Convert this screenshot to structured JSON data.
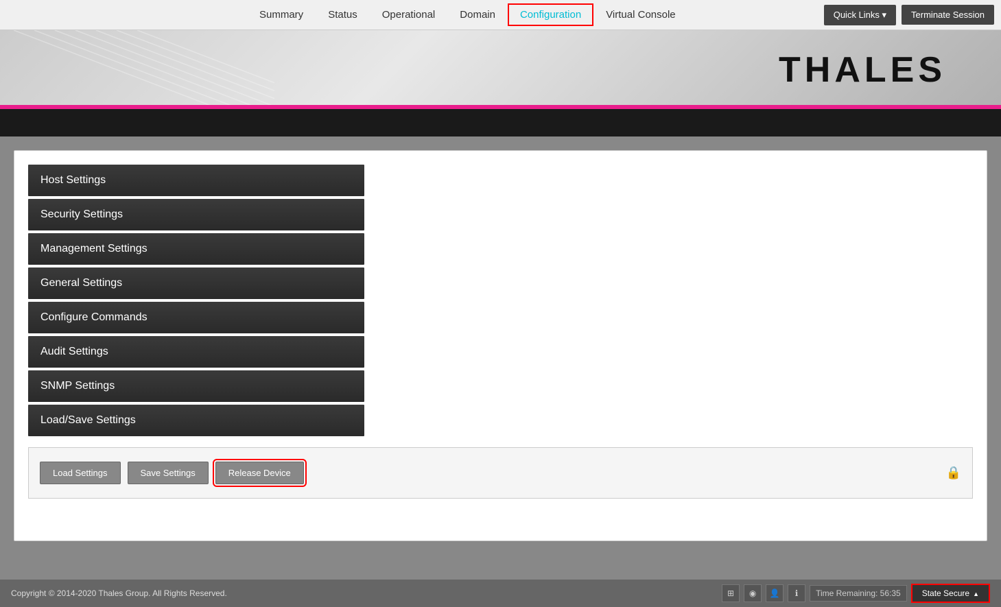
{
  "nav": {
    "links": [
      {
        "label": "Summary",
        "id": "summary",
        "active": false
      },
      {
        "label": "Status",
        "id": "status",
        "active": false
      },
      {
        "label": "Operational",
        "id": "operational",
        "active": false
      },
      {
        "label": "Domain",
        "id": "domain",
        "active": false
      },
      {
        "label": "Configuration",
        "id": "configuration",
        "active": true
      },
      {
        "label": "Virtual Console",
        "id": "virtual-console",
        "active": false
      }
    ],
    "quick_links_label": "Quick Links ▾",
    "terminate_label": "Terminate Session"
  },
  "header": {
    "logo": "THALES"
  },
  "menu": {
    "items": [
      {
        "label": "Host Settings"
      },
      {
        "label": "Security Settings"
      },
      {
        "label": "Management Settings"
      },
      {
        "label": "General Settings"
      },
      {
        "label": "Configure Commands"
      },
      {
        "label": "Audit Settings"
      },
      {
        "label": "SNMP Settings"
      },
      {
        "label": "Load/Save Settings"
      }
    ]
  },
  "actions": {
    "load_label": "Load Settings",
    "save_label": "Save Settings",
    "release_label": "Release Device"
  },
  "footer": {
    "copyright": "Copyright © 2014-2020 Thales Group. All Rights Reserved.",
    "time_label": "Time Remaining: 56:35",
    "state_label": "State Secure"
  }
}
